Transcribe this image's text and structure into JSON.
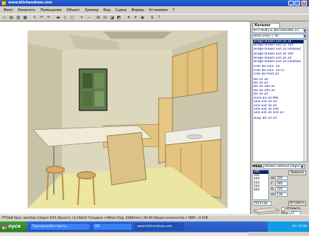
{
  "window": {
    "title": "www.kitchendraw.com",
    "btn_min": "_",
    "btn_max": "□",
    "btn_close": "x"
  },
  "menu": [
    "Файл",
    "Изменить",
    "Помещение",
    "Объект",
    "Зуммер",
    "Вид",
    "Сцена",
    "Формы",
    "Установки",
    "?"
  ],
  "toolbar": [
    "new-icon",
    "open-icon",
    "save-icon",
    "print-icon",
    "sep",
    "select-icon",
    "undo-icon",
    "redo-icon",
    "sep",
    "wall-icon",
    "door-icon",
    "window-icon",
    "sep",
    "zoom-in-icon",
    "zoom-out-icon",
    "sep",
    "top-view-icon",
    "front-view-icon",
    "3d-view-icon",
    "perspective-icon",
    "sep",
    "render-icon",
    "light-icon",
    "camera-icon",
    "sep",
    "estimate-icon",
    "help-icon"
  ],
  "toolbar_glyphs": [
    "▭",
    "▤",
    "▥",
    "▦",
    "",
    "↖",
    "↶",
    "↷",
    "",
    "▬",
    "▯",
    "▢",
    "",
    "+",
    "−",
    "",
    "⊞",
    "⊟",
    "◪",
    "◩",
    "",
    "✦",
    "☀",
    "◉",
    "",
    "$",
    "?"
  ],
  "panel": {
    "tab": "Каталог",
    "catalog": "KITCHENS & BATHROOMS V3",
    "category": "Base units < 40",
    "items": [
      "Bridge drawer unit 1D 1d",
      "Bridge drawer unit 1U 1Vd",
      "Bridge drawer unit 1U (shallow)",
      "",
      "Bridge drawer unit 2U 1PD",
      "Bridge drawer unit 2U 2d",
      "Bridge drawer unit 2U (shallow)",
      "",
      "Filler BU conc. 2U",
      "Filler BU conc. 2U FC",
      "Filler BU front 2U",
      "",
      "BU 1U 1D",
      "BU 2U 2D",
      "BU 2U 1PD 1d",
      "BU 3U 1PD 1d",
      "BU 3U 2d",
      "Oven BU 3U MW",
      "Sink unit 3U 1D",
      "Sink unit 3U 2D",
      "Sink unit 3U 1PD",
      "Sink unit 3U 1PD 1d",
      "",
      "Diag. BU 3U 1D"
    ],
    "selected_index": 0,
    "facade_label": "МЕБЕ",
    "facade_value": "Modern without edges",
    "sizes": [
      "300",
      "350",
      "400",
      "450",
      "500",
      "600"
    ],
    "selected_size": 0,
    "width_btn": "Ширина",
    "w_label": "Ш",
    "w_value": "300",
    "d_label": "Г",
    "d_value": "580",
    "h_label": "В",
    "h_value": "720",
    "offset_label": "От",
    "offset_value": "138",
    "ref_value": "TP11T30",
    "insert_btn": "Вставить",
    "open_label": "Открыть",
    "pos_label": "Пол",
    "pos_value": "2",
    "count_value": "60"
  },
  "status": "PTG&B  Spec. worktop (shape) #35 (Высота +1,164mt Толщина +39mm Под. 2380mm)   |  00.00 Общее количество с ПВМ =0 EUR",
  "taskbar": {
    "start": "пуск",
    "tasks": [
      "Просмотр/Изм прогр...",
      "KD",
      "www.kitchendraw.com"
    ],
    "active_task": 2,
    "tray_lang": "RU",
    "clock": "14:08"
  }
}
